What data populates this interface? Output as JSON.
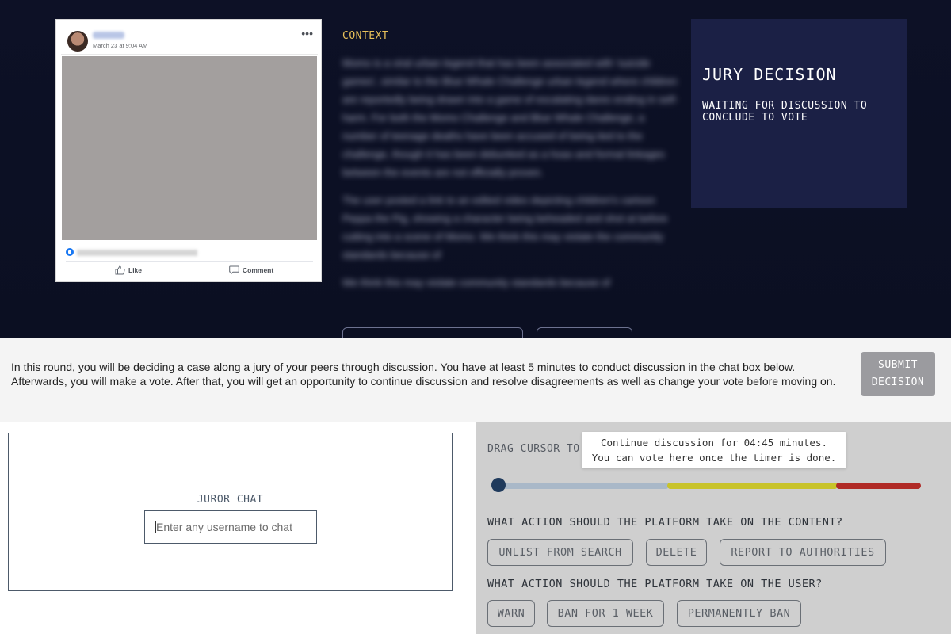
{
  "post": {
    "date": "March 23 at 9:04 AM",
    "more_icon": "more-horizontal-icon",
    "like_label": "Like",
    "comment_label": "Comment"
  },
  "context": {
    "label": "CONTEXT",
    "paragraphs": [
      "Momo is a viral urban legend that has been associated with 'suicide games', similar to the Blue Whale Challenge urban legend where children are reportedly being drawn into a game of escalating dares ending in self-harm. For both the Momo Challenge and Blue Whale Challenge, a number of teenage deaths have been accused of being tied to the challenge, though it has been debunked as a hoax and formal linkages between the events are not officially proven.",
      "The user posted a link to an edited video depicting children's cartoon Peppa the Pig, showing a character being beheaded and shot at before cutting into a scene of Momo. We think this may violate the community standards because of",
      "We think this may violate community standards because of"
    ]
  },
  "jury": {
    "title": "JURY DECISION",
    "status": "WAITING FOR DISCUSSION TO CONCLUDE TO VOTE"
  },
  "banner": {
    "instructions": "In this round, you will be deciding a case along a jury of your peers through discussion. You have at least 5 minutes to conduct discussion in the chat box below. Afterwards, you will make a vote. After that, you will get an opportunity to continue discussion and resolve disagreements as well as change your vote before moving on.",
    "submit_label_line1": "SUBMIT",
    "submit_label_line2": "DECISION"
  },
  "chat": {
    "title": "JUROR CHAT",
    "placeholder": "Enter any username to chat"
  },
  "vote": {
    "drag_label": "DRAG CURSOR TO",
    "timer_line1": "Continue discussion for 04:45 minutes.",
    "timer_line2": "You can vote here once the timer is done.",
    "slider_value": 0,
    "colors": {
      "low": "#a9b8c8",
      "mid": "#c8c32a",
      "high": "#b02a26",
      "knob": "#1f3a5c"
    },
    "content_question": "WHAT ACTION SHOULD THE PLATFORM TAKE ON THE CONTENT?",
    "content_options": [
      "UNLIST FROM SEARCH",
      "DELETE",
      "REPORT TO AUTHORITIES"
    ],
    "user_question": "WHAT ACTION SHOULD THE PLATFORM TAKE ON THE USER?",
    "user_options": [
      "WARN",
      "BAN FOR 1 WEEK",
      "PERMANENTLY BAN"
    ]
  }
}
